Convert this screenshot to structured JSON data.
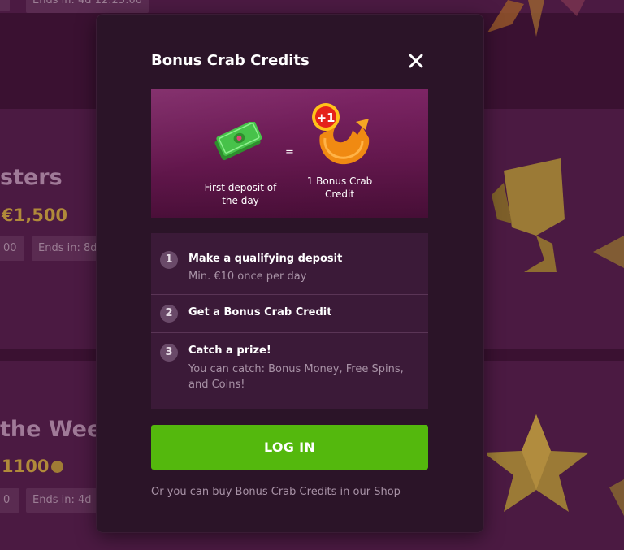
{
  "background": {
    "top_chip": "Ends in: 4d 12:25:00",
    "card1": {
      "title": "sters",
      "prize": "€1,500",
      "chip_a": "00",
      "chip_b": "Ends in: 8d"
    },
    "card2": {
      "title": "the Week",
      "prize": "1100",
      "chip_a": "0",
      "chip_b": "Ends in: 4d"
    }
  },
  "modal": {
    "title": "Bonus Crab Credits",
    "close_icon": "close-icon",
    "banner": {
      "badge": "+1",
      "equals": "=",
      "left_caption": "First deposit of the day",
      "right_caption": "1 Bonus Crab Credit"
    },
    "steps": [
      {
        "number": "1",
        "title": "Make a qualifying deposit",
        "desc": "Min. €10 once per day"
      },
      {
        "number": "2",
        "title": "Get a Bonus Crab Credit",
        "desc": ""
      },
      {
        "number": "3",
        "title": "Catch a prize!",
        "desc": "You can catch: Bonus Money, Free Spins, and Coins!"
      }
    ],
    "login_label": "LOG IN",
    "footer_text": "Or you can buy Bonus Crab Credits in our",
    "footer_link": "Shop"
  },
  "colors": {
    "accent_green": "#54b80d",
    "modal_bg": "#2b1428",
    "banner_purple": "#7d2565"
  }
}
